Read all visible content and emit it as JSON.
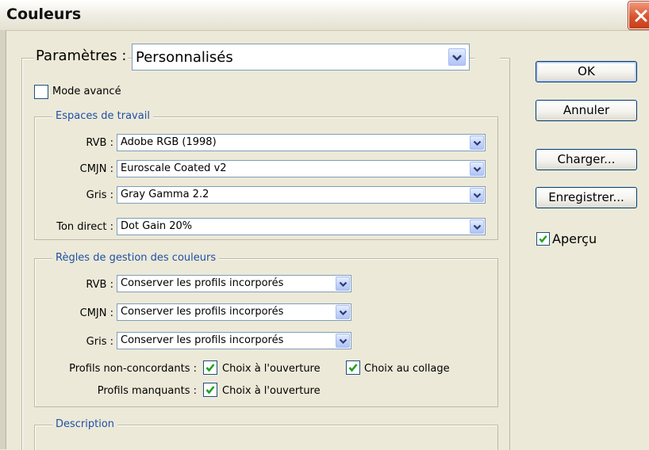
{
  "window": {
    "title": "Couleurs"
  },
  "parametres": {
    "label": "Paramètres :",
    "value": "Personnalisés"
  },
  "mode_avance": {
    "label": "Mode avancé",
    "checked": false
  },
  "espaces": {
    "legend": "Espaces de travail",
    "rows": [
      {
        "label": "RVB :",
        "value": "Adobe RGB (1998)"
      },
      {
        "label": "CMJN :",
        "value": "Euroscale Coated v2"
      },
      {
        "label": "Gris :",
        "value": "Gray Gamma 2.2"
      },
      {
        "label": "Ton direct :",
        "value": "Dot Gain 20%"
      }
    ]
  },
  "regles": {
    "legend": "Règles de gestion des couleurs",
    "rows": [
      {
        "label": "RVB :",
        "value": "Conserver les profils incorporés"
      },
      {
        "label": "CMJN :",
        "value": "Conserver les profils incorporés"
      },
      {
        "label": "Gris :",
        "value": "Conserver les profils incorporés"
      }
    ],
    "non_concordants": {
      "label": "Profils non-concordants :",
      "ouverture": "Choix à l'ouverture",
      "collage": "Choix au collage"
    },
    "manquants": {
      "label": "Profils manquants :",
      "ouverture": "Choix à l'ouverture"
    }
  },
  "description": {
    "legend": "Description"
  },
  "buttons": {
    "ok": "OK",
    "annuler": "Annuler",
    "charger": "Charger...",
    "enregistrer": "Enregistrer..."
  },
  "apercu": {
    "label": "Aperçu",
    "checked": true
  },
  "colors": {
    "legend": "#1e50a8",
    "check": "#21a121",
    "close": "#d9532b"
  }
}
